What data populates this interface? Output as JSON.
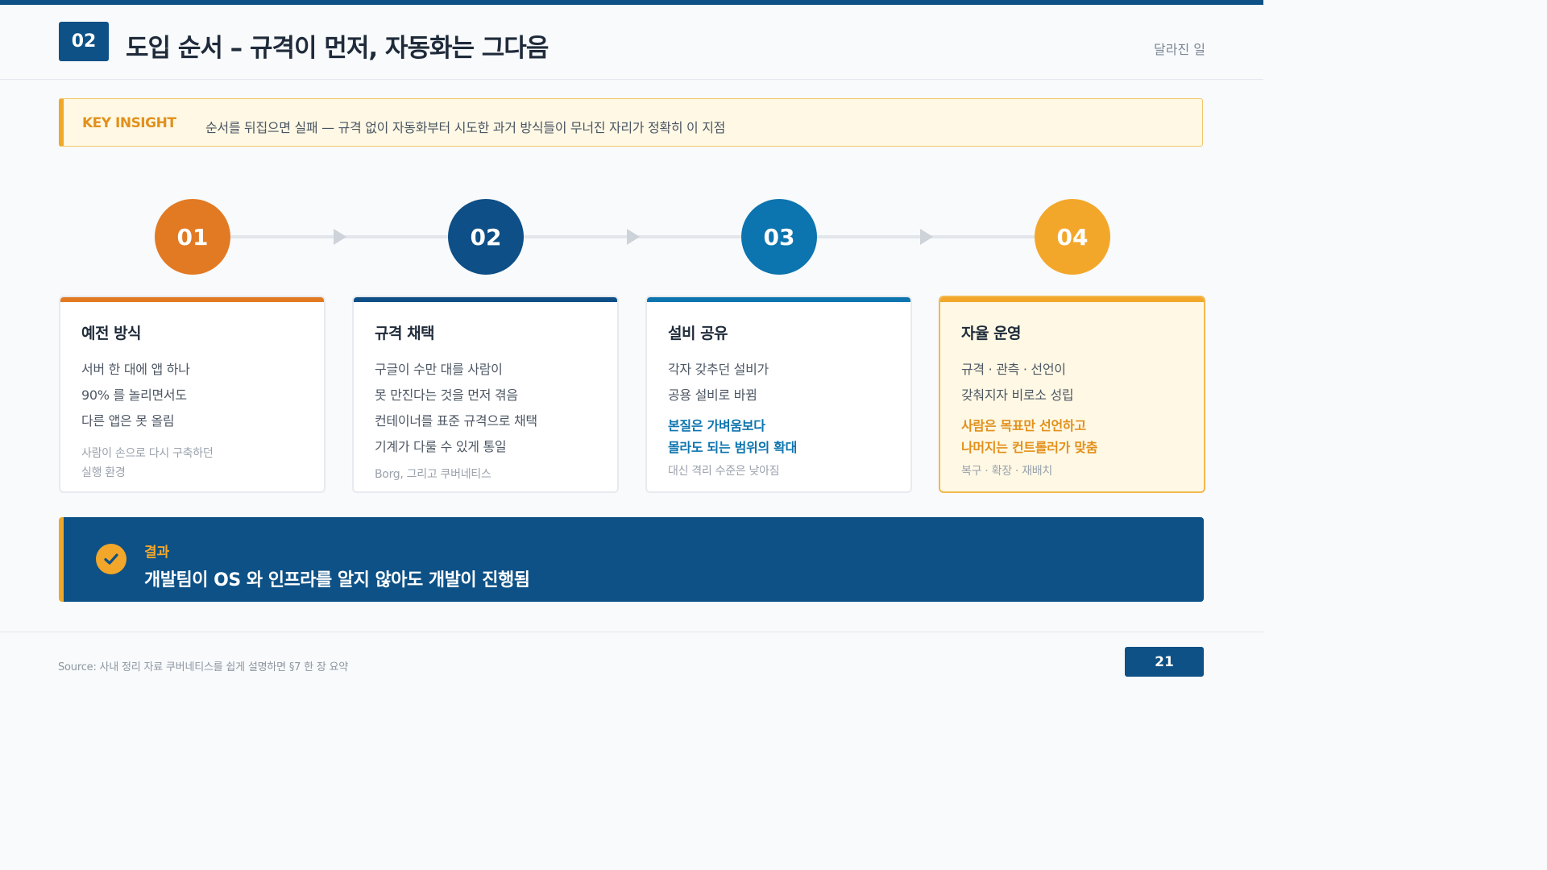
{
  "header": {
    "badge": "02",
    "title": "도입 순서 – 규격이 먼저, 자동화는 그다음",
    "section_tag": "달라진 일"
  },
  "insight": {
    "label": "KEY INSIGHT",
    "text": "순서를 뒤집으면 실패 — 규격 없이 자동화부터 시도한 과거 방식들이 무너진 자리가 정확히 이 지점"
  },
  "steps": [
    {
      "number": "01",
      "color": "#e27a23",
      "title": "예전 방식",
      "lines": [
        "서버 한 대에 앱 하나",
        "90% 를 놀리면서도",
        "다른 앱은 못 올림"
      ],
      "emphasis": [],
      "emphasis_color": "",
      "notes": [
        "사람이 손으로 다시 구축하던",
        "실행 환경"
      ]
    },
    {
      "number": "02",
      "color": "#0d4f86",
      "title": "규격 채택",
      "lines": [
        "구글이 수만 대를 사람이",
        "못 만진다는 것을 먼저 겪음",
        "컨테이너를 표준 규격으로 채택",
        "기계가 다룰 수 있게 통일"
      ],
      "emphasis": [],
      "emphasis_color": "",
      "notes": [
        "Borg, 그리고 쿠버네티스"
      ]
    },
    {
      "number": "03",
      "color": "#0c74ae",
      "title": "설비 공유",
      "lines": [
        "각자 갖추던 설비가",
        "공용 설비로 바뀜"
      ],
      "emphasis": [
        "본질은 가벼움보다",
        "몰라도 되는 범위의 확대"
      ],
      "emphasis_color": "#0c74ae",
      "notes": [
        "대신 격리 수준은 낮아짐"
      ]
    },
    {
      "number": "04",
      "color": "#f3a72a",
      "title": "자율 운영",
      "lines": [
        "규격 · 관측 · 선언이",
        "갖춰지자 비로소 성립"
      ],
      "emphasis": [
        "사람은 목표만 선언하고",
        "나머지는 컨트롤러가 맞춤"
      ],
      "emphasis_color": "#e2901b",
      "notes": [
        "복구 · 확장 · 재배치"
      ]
    }
  ],
  "result": {
    "label": "결과",
    "text": "개발팀이 OS 와 인프라를 알지 않아도 개발이 진행됨"
  },
  "footer": {
    "source": "Source: 사내 정리 자료 쿠버네티스를 쉽게 설명하면 §7 한 장 요약",
    "page_number": "21"
  }
}
